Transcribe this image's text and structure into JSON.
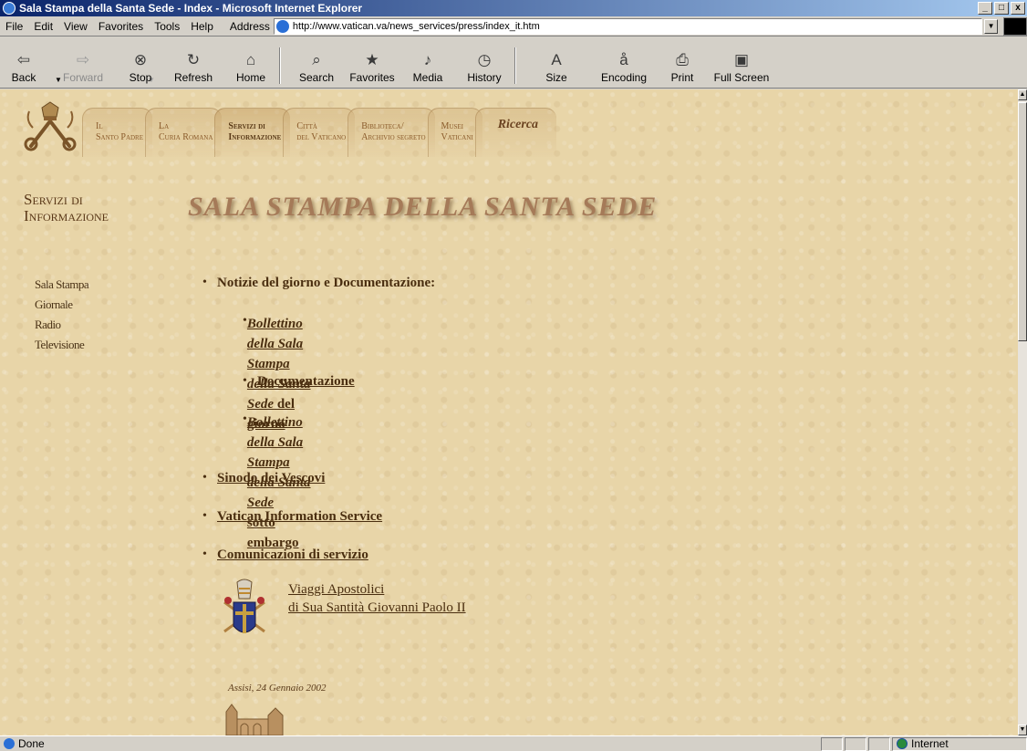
{
  "window": {
    "title": "Sala Stampa della Santa Sede - Index - Microsoft Internet Explorer",
    "controls": [
      "_",
      "□",
      "x"
    ]
  },
  "menu": {
    "items": [
      "File",
      "Edit",
      "View",
      "Favorites",
      "Tools",
      "Help"
    ],
    "address_label": "Address",
    "address_url": "http://www.vatican.va/news_services/press/index_it.htm"
  },
  "toolbar": {
    "buttons": [
      {
        "label": "Back",
        "icon": "back-arrow-icon",
        "glyph": "⇦"
      },
      {
        "label": "Forward",
        "icon": "forward-arrow-icon",
        "glyph": "⇨"
      },
      {
        "label": "Stop",
        "icon": "stop-icon",
        "glyph": "⊗"
      },
      {
        "label": "Refresh",
        "icon": "refresh-icon",
        "glyph": "↻"
      },
      {
        "label": "Home",
        "icon": "home-icon",
        "glyph": "⌂"
      },
      {
        "label": "Search",
        "icon": "search-icon",
        "glyph": "⌕"
      },
      {
        "label": "Favorites",
        "icon": "favorites-icon",
        "glyph": "★"
      },
      {
        "label": "Media",
        "icon": "media-icon",
        "glyph": "♪"
      },
      {
        "label": "History",
        "icon": "history-icon",
        "glyph": "◷"
      },
      {
        "label": "Size",
        "icon": "text-size-icon",
        "glyph": "A"
      },
      {
        "label": "Encoding",
        "icon": "encoding-icon",
        "glyph": "å"
      },
      {
        "label": "Print",
        "icon": "print-icon",
        "glyph": "⎙"
      },
      {
        "label": "Full Screen",
        "icon": "full-screen-icon",
        "glyph": "▣"
      }
    ]
  },
  "site": {
    "tabs": [
      {
        "line1": "Il",
        "line2": "Santo Padre"
      },
      {
        "line1": "La",
        "line2": "Curia Romana"
      },
      {
        "line1": "Servizi di",
        "line2": "Informazione"
      },
      {
        "line1": "Città",
        "line2": "del Vaticano"
      },
      {
        "line1": "Biblioteca/",
        "line2": "Archivio segreto"
      },
      {
        "line1": "Musei",
        "line2": "Vaticani"
      },
      {
        "line1": "Ricerca",
        "line2": ""
      }
    ],
    "section_title_line1": "Servizi di",
    "section_title_line2": "Informazione",
    "banner": "SALA STAMPA DELLA SANTA SEDE",
    "sidenav": [
      "Sala Stampa",
      "Giornale",
      "Radio",
      "Televisione"
    ],
    "main": {
      "notizie_label": "Notizie del giorno e Documentazione:",
      "bollettino_italic": "Bollettino della Sala Stampa della Santa Sede",
      "bollettino_rest": " del",
      "bollettino_line2": "giorno",
      "documentazione": "Documentazione",
      "embargo_italic": "Bollettino della Sala Stampa della Santa Sede",
      "embargo_line2": "sotto embargo",
      "sinodo": "Sinodo dei Vescovi",
      "vis": "Vatican Information Service",
      "comunicazioni": "Comunicazioni di servizio",
      "viaggi_line1": "Viaggi Apostolici",
      "viaggi_line2": "di Sua Santità Giovanni Paolo II",
      "assisi_caption": "Assisi, 24 Gennaio 2002"
    }
  },
  "status": {
    "text": "Done",
    "zone": "Internet"
  }
}
